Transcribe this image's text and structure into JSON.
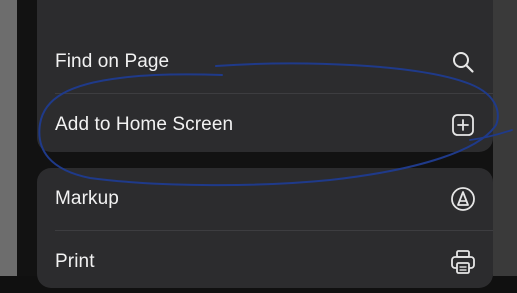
{
  "menu": {
    "group1": [
      {
        "label": "Find on Page",
        "icon": "magnifier-icon"
      },
      {
        "label": "Add to Home Screen",
        "icon": "plus-square-icon"
      }
    ],
    "group2": [
      {
        "label": "Markup",
        "icon": "markup-pen-icon"
      },
      {
        "label": "Print",
        "icon": "printer-icon"
      }
    ]
  },
  "colors": {
    "panel": "#2c2c2e",
    "text": "#f2f2f2",
    "annotation": "#1f3a8a"
  }
}
